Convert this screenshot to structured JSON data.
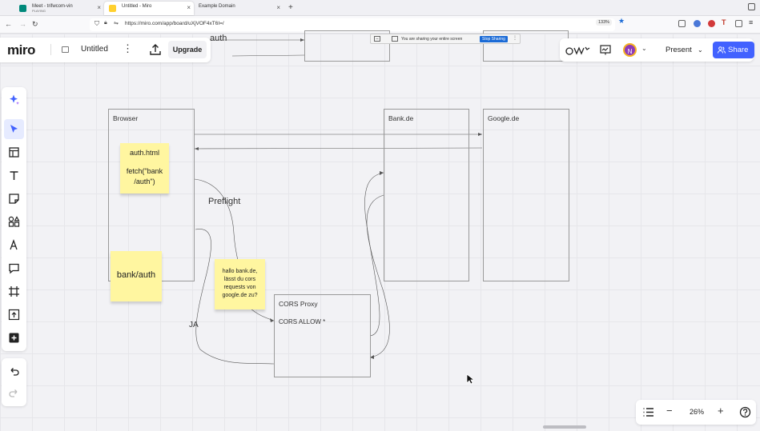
{
  "browser": {
    "tabs": [
      {
        "title": "Meet - trifwcom-vin",
        "subtitle": "PLAYING"
      },
      {
        "title": "Untitled - Miro"
      },
      {
        "title": "Example Domain"
      }
    ],
    "url": "https://miro.com/app/board/uXjVOF4xT6I=/",
    "zoom": "133%"
  },
  "toolbar_left": {
    "logo": "miro",
    "board_name": "Untitled",
    "upgrade_label": "Upgrade"
  },
  "share_banner": {
    "text": "You are sharing your entire screen",
    "stop_label": "Stop Sharing"
  },
  "toolbar_right": {
    "avatar_initial": "N",
    "present_label": "Present",
    "share_label": "Share"
  },
  "zoom_toolbar": {
    "zoom": "26%"
  },
  "board": {
    "top_text": "auth",
    "frames": [
      {
        "title": "Browser"
      },
      {
        "title": "Bank.de"
      },
      {
        "title": "Google.de"
      },
      {
        "title": "CORS Proxy",
        "body": "CORS ALLOW *"
      }
    ],
    "stickies": [
      {
        "lines": [
          "auth.html",
          "",
          "fetch(\"bank",
          "/auth\")"
        ]
      },
      {
        "lines": [
          "bank/auth"
        ]
      },
      {
        "lines": [
          "hallo bank.de,",
          "lässt du cors",
          "requests von",
          "google.de zu?"
        ]
      }
    ],
    "labels": {
      "preflight": "Preflight",
      "ja": "JA"
    }
  },
  "colors": {
    "accent": "#4262ff",
    "sticky": "#fff6a0",
    "avatar": "#8e3bb8"
  },
  "icons": [
    "ai-sparkle-icon",
    "select-icon",
    "templates-icon",
    "text-icon",
    "sticky-note-icon",
    "shapes-icon",
    "pen-icon",
    "comment-icon",
    "frame-icon",
    "upload-icon",
    "add-icon",
    "undo-icon",
    "redo-icon",
    "list-icon",
    "help-icon"
  ]
}
